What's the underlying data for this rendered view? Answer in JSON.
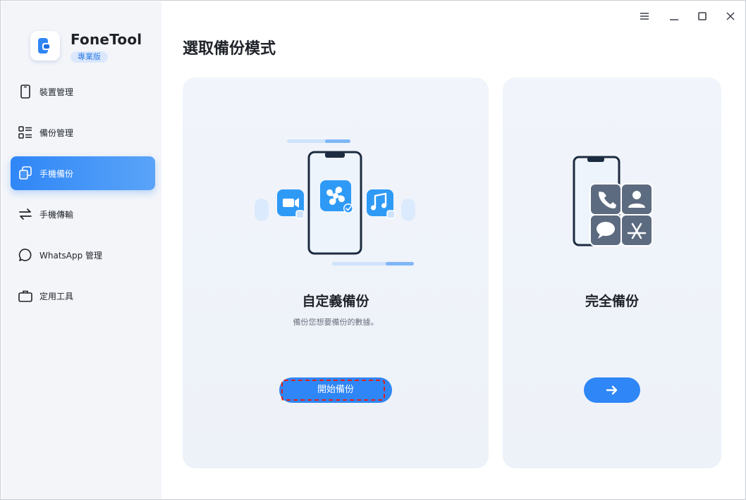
{
  "app": {
    "name": "FoneTool",
    "edition": "專業版"
  },
  "sidebar": {
    "items": [
      {
        "label": "裝置管理",
        "icon": "phone-icon",
        "active": false
      },
      {
        "label": "備份管理",
        "icon": "list-icon",
        "active": false
      },
      {
        "label": "手機備份",
        "icon": "copy-icon",
        "active": true
      },
      {
        "label": "手機傳輸",
        "icon": "transfer-arrows-icon",
        "active": false
      },
      {
        "label": "WhatsApp 管理",
        "icon": "chat-bubble-icon",
        "active": false
      },
      {
        "label": "定用工具",
        "icon": "briefcase-icon",
        "active": false
      }
    ]
  },
  "window_controls": [
    "menu-icon",
    "minimize-icon",
    "maximize-icon",
    "close-icon"
  ],
  "main": {
    "title": "選取備份模式",
    "cards": {
      "custom": {
        "title": "自定義備份",
        "description": "備份您想要備份的數據。",
        "button_label": "開始備份"
      },
      "full": {
        "title": "完全備份",
        "button_icon": "arrow-right-icon"
      }
    }
  },
  "colors": {
    "accent": "#2f86f6",
    "sidebar_bg": "#f3f5f9",
    "card_bg": "#eff3fa",
    "badge_bg": "#dbe8fc",
    "focus_ring": "#e0201c",
    "dark_navy": "#1d2b40"
  }
}
